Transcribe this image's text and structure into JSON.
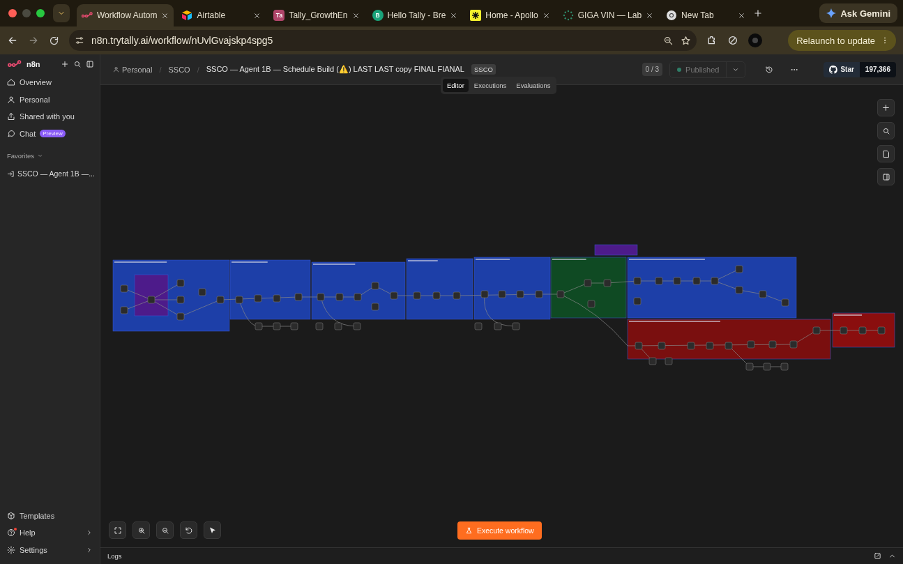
{
  "browser": {
    "tabs": [
      {
        "title": "Workflow Autom",
        "selected": true
      },
      {
        "title": "Airtable",
        "selected": false
      },
      {
        "title": "Tally_GrowthEn",
        "selected": false,
        "icon_text": "Ta"
      },
      {
        "title": "Hello Tally - Bre",
        "selected": false,
        "icon_text": "B"
      },
      {
        "title": "Home - Apollo",
        "selected": false
      },
      {
        "title": "GIGA VIN — Lab",
        "selected": false
      },
      {
        "title": "New Tab",
        "selected": false
      }
    ],
    "gemini_button": "Ask Gemini",
    "url": "n8n.trytally.ai/workflow/nUvlGvajskp4spg5",
    "relaunch_button": "Relaunch to update"
  },
  "sidebar": {
    "logo": "n8n",
    "nav": [
      {
        "label": "Overview"
      },
      {
        "label": "Personal"
      },
      {
        "label": "Shared with you"
      },
      {
        "label": "Chat",
        "badge": "Preview"
      }
    ],
    "favorites_heading": "Favorites",
    "favorites": [
      "SSCO — Agent 1B —..."
    ],
    "bottom": [
      {
        "label": "Templates",
        "chevron": false,
        "notification": false
      },
      {
        "label": "Help",
        "chevron": true,
        "notification": true
      },
      {
        "label": "Settings",
        "chevron": true,
        "notification": false
      }
    ]
  },
  "header": {
    "breadcrumb": [
      {
        "label": "Personal",
        "separator": "/"
      },
      {
        "label": "SSCO",
        "separator": "/"
      }
    ],
    "title": "SSCO — Agent 1B — Schedule Build (⚠️) LAST LAST copy FINAL FIANAL",
    "tag": "SSCO",
    "tabs": [
      {
        "label": "Editor",
        "selected": true
      },
      {
        "label": "Executions",
        "selected": false
      },
      {
        "label": "Evaluations",
        "selected": false
      }
    ],
    "counter": "0 / 3",
    "status": "Published",
    "github_star": "Star",
    "github_count": "197,366"
  },
  "canvas": {
    "execute_button": "Execute workflow"
  },
  "logs": {
    "label": "Logs"
  }
}
